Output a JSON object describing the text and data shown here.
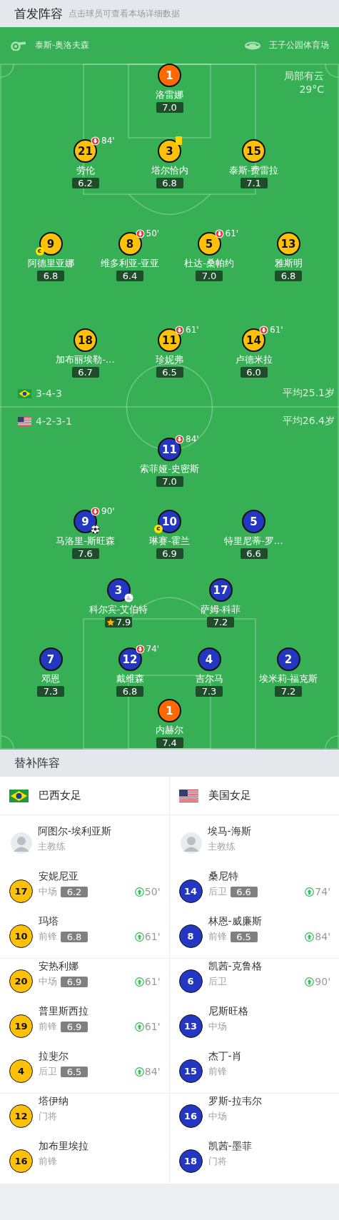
{
  "header": {
    "title": "首发阵容",
    "subtitle": "点击球员可查看本场详细数据"
  },
  "match": {
    "referee": "泰斯-奥洛夫森",
    "venue": "王子公园体育场",
    "weather": "局部有云",
    "temperature": "29°C"
  },
  "lineup": {
    "teams": [
      {
        "flag": {
          "kind": "brazil"
        },
        "color": "#ffc107",
        "formation": "3-4-3",
        "average_age": "平均25.1岁",
        "lines": [
          [
            {
              "number": "1",
              "name": "洛雷娜",
              "rating": "7.0",
              "kind": "goalkeeper"
            }
          ],
          [
            {
              "number": "21",
              "name": "劳伦",
              "rating": "6.2",
              "kind": "outfield",
              "events": [
                {
                  "kind": "sub_off",
                  "minute": "84'"
                }
              ]
            },
            {
              "number": "3",
              "name": "塔尔恰内",
              "rating": "6.8",
              "kind": "outfield",
              "events": [
                {
                  "kind": "yellow_card"
                }
              ]
            },
            {
              "number": "15",
              "name": "泰斯-费雷拉",
              "rating": "7.1",
              "kind": "outfield"
            }
          ],
          [
            {
              "number": "9",
              "name": "阿德里亚娜",
              "rating": "6.8",
              "kind": "outfield",
              "events": [
                {
                  "kind": "captain",
                  "label": "c"
                }
              ]
            },
            {
              "number": "8",
              "name": "维多利亚-亚亚",
              "rating": "6.4",
              "kind": "outfield",
              "events": [
                {
                  "kind": "sub_off",
                  "minute": "50'"
                }
              ]
            },
            {
              "number": "5",
              "name": "杜达-桑帕约",
              "rating": "7.0",
              "kind": "outfield",
              "events": [
                {
                  "kind": "sub_off",
                  "minute": "61'"
                }
              ]
            },
            {
              "number": "13",
              "name": "雅斯明",
              "rating": "6.8",
              "kind": "outfield"
            }
          ],
          [
            {
              "number": "18",
              "name": "加布丽埃勒-…",
              "rating": "6.7",
              "kind": "outfield"
            },
            {
              "number": "11",
              "name": "珍妮弗",
              "rating": "6.5",
              "kind": "outfield",
              "events": [
                {
                  "kind": "sub_off",
                  "minute": "61'"
                }
              ]
            },
            {
              "number": "14",
              "name": "卢德米拉",
              "rating": "6.0",
              "kind": "outfield",
              "events": [
                {
                  "kind": "sub_off",
                  "minute": "61'"
                }
              ]
            }
          ]
        ]
      },
      {
        "flag": {
          "kind": "usa"
        },
        "color": "#2437c2",
        "formation": "4-2-3-1",
        "average_age": "平均26.4岁",
        "lines": [
          [
            {
              "number": "11",
              "name": "索菲娅-史密斯",
              "rating": "7.0",
              "kind": "outfield",
              "events": [
                {
                  "kind": "sub_off",
                  "minute": "84'"
                }
              ]
            }
          ],
          [
            {
              "number": "9",
              "name": "马洛里-斯旺森",
              "rating": "7.6",
              "kind": "outfield",
              "events": [
                {
                  "kind": "sub_off",
                  "minute": "90'"
                },
                {
                  "kind": "goal"
                }
              ]
            },
            {
              "number": "10",
              "name": "琳赛-霍兰",
              "rating": "6.9",
              "kind": "outfield",
              "events": [
                {
                  "kind": "captain",
                  "label": "c"
                }
              ]
            },
            {
              "number": "5",
              "name": "特里尼蒂-罗…",
              "rating": "6.6",
              "kind": "outfield"
            }
          ],
          [
            {
              "number": "3",
              "name": "科尔宾-艾伯特",
              "rating": "7.9",
              "kind": "outfield",
              "events": [
                {
                  "kind": "assist"
                },
                {
                  "kind": "top_rated"
                }
              ]
            },
            {
              "number": "17",
              "name": "萨姆-科菲",
              "rating": "7.2",
              "kind": "outfield"
            }
          ],
          [
            {
              "number": "7",
              "name": "邓恩",
              "rating": "7.3",
              "kind": "outfield"
            },
            {
              "number": "12",
              "name": "戴维森",
              "rating": "6.8",
              "kind": "outfield",
              "events": [
                {
                  "kind": "sub_off",
                  "minute": "74'"
                }
              ]
            },
            {
              "number": "4",
              "name": "吉尔马",
              "rating": "7.3",
              "kind": "outfield"
            },
            {
              "number": "2",
              "name": "埃米莉-福克斯",
              "rating": "7.2",
              "kind": "outfield"
            }
          ],
          [
            {
              "number": "1",
              "name": "内赫尔",
              "rating": "7.4",
              "kind": "goalkeeper"
            }
          ]
        ]
      }
    ]
  },
  "substitutes": {
    "title": "替补阵容",
    "teams": [
      {
        "name": "巴西女足",
        "flag": {
          "kind": "brazil"
        },
        "color": "#ffc107",
        "coach": {
          "name": "阿图尔-埃利亚斯",
          "role": "主教练"
        },
        "players": [
          {
            "number": "17",
            "name": "安妮尼亚",
            "position": "中场",
            "rating": "6.2",
            "sub_on": "50'"
          },
          {
            "number": "10",
            "name": "玛塔",
            "position": "前锋",
            "rating": "6.8",
            "sub_on": "61'"
          },
          {
            "number": "20",
            "name": "安热利娜",
            "position": "中场",
            "rating": "6.9",
            "sub_on": "61'"
          },
          {
            "number": "19",
            "name": "普里斯西拉",
            "position": "前锋",
            "rating": "6.9",
            "sub_on": "61'"
          },
          {
            "number": "4",
            "name": "拉斐尔",
            "position": "后卫",
            "rating": "6.5",
            "sub_on": "84'"
          },
          {
            "number": "12",
            "name": "塔伊纳",
            "position": "门将"
          },
          {
            "number": "16",
            "name": "加布里埃拉",
            "position": "前锋"
          }
        ]
      },
      {
        "name": "美国女足",
        "flag": {
          "kind": "usa"
        },
        "color": "#2437c2",
        "coach": {
          "name": "埃马-海斯",
          "role": "主教练"
        },
        "players": [
          {
            "number": "14",
            "name": "桑尼特",
            "position": "后卫",
            "rating": "6.6",
            "sub_on": "74'"
          },
          {
            "number": "8",
            "name": "林恩-威廉斯",
            "position": "前锋",
            "rating": "6.5",
            "sub_on": "84'"
          },
          {
            "number": "6",
            "name": "凯茜-克鲁格",
            "position": "后卫",
            "sub_on": "90'"
          },
          {
            "number": "13",
            "name": "尼斯旺格",
            "position": "中场"
          },
          {
            "number": "15",
            "name": "杰丁-肖",
            "position": "前锋"
          },
          {
            "number": "16",
            "name": "罗斯-拉韦尔",
            "position": "中场"
          },
          {
            "number": "18",
            "name": "凯茜-墨菲",
            "position": "门将"
          }
        ]
      }
    ]
  }
}
